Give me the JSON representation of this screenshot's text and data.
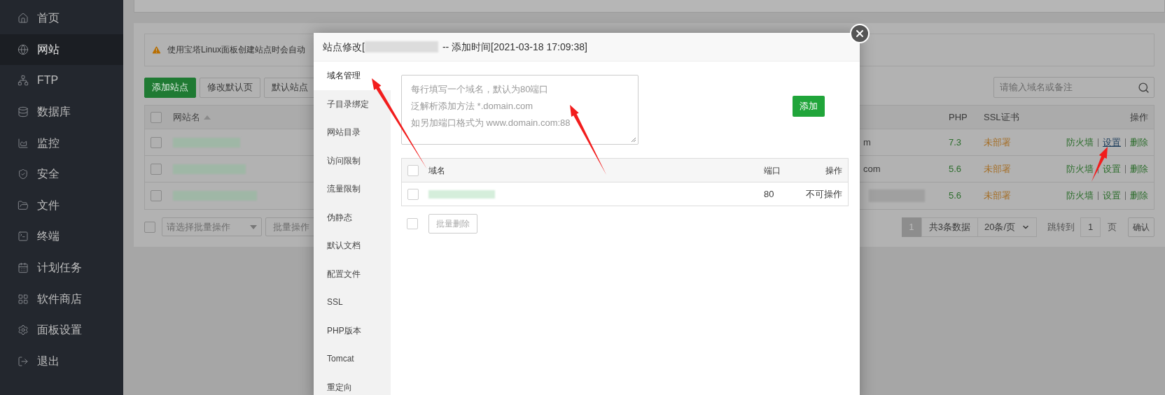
{
  "sidebar": {
    "items": [
      {
        "label": "首页",
        "selected": false
      },
      {
        "label": "网站",
        "selected": true
      },
      {
        "label": "FTP",
        "selected": false
      },
      {
        "label": "数据库",
        "selected": false
      },
      {
        "label": "监控",
        "selected": false
      },
      {
        "label": "安全",
        "selected": false
      },
      {
        "label": "文件",
        "selected": false
      },
      {
        "label": "终端",
        "selected": false
      },
      {
        "label": "计划任务",
        "selected": false
      },
      {
        "label": "软件商店",
        "selected": false
      },
      {
        "label": "面板设置",
        "selected": false
      },
      {
        "label": "退出",
        "selected": false
      }
    ]
  },
  "notice": "使用宝塔Linux面板创建站点时会自动",
  "toolbar": {
    "buttons": [
      {
        "label": "添加站点",
        "kind": "primary"
      },
      {
        "label": "修改默认页",
        "kind": "default"
      },
      {
        "label": "默认站点",
        "kind": "default"
      }
    ],
    "search": {
      "placeholder": "请输入域名或备注"
    }
  },
  "sites_table": {
    "header_checked": false,
    "columns": {
      "name": "网站名",
      "php": "PHP",
      "ssl": "SSL证书",
      "actions": "操作"
    },
    "rows": [
      {
        "checked": false,
        "tail": "m",
        "tail_blurred": false,
        "php": "7.3",
        "ssl": "未部署",
        "actions": [
          {
            "label": "防火墙",
            "hovered": false
          },
          {
            "label": "设置",
            "hovered": true
          },
          {
            "label": "删除",
            "hovered": false
          }
        ]
      },
      {
        "checked": false,
        "tail": "com",
        "tail_blurred": false,
        "php": "5.6",
        "ssl": "未部署",
        "actions": [
          {
            "label": "防火墙",
            "hovered": false
          },
          {
            "label": "设置",
            "hovered": false
          },
          {
            "label": "删除",
            "hovered": false
          }
        ]
      },
      {
        "checked": false,
        "tail": "",
        "tail_blurred": true,
        "php": "5.6",
        "ssl": "未部署",
        "actions": [
          {
            "label": "防火墙",
            "hovered": false
          },
          {
            "label": "设置",
            "hovered": false
          },
          {
            "label": "删除",
            "hovered": false
          }
        ]
      }
    ]
  },
  "footer": {
    "checked": false,
    "batch_select": {
      "placeholder": "请选择批量操作"
    },
    "batch_button": "批量操作",
    "pagination": {
      "current": "1",
      "total": "共3条数据",
      "per_page": "20条/页",
      "jump_label": "跳转到",
      "jump_value": "1",
      "page_unit": "页",
      "confirm": "确认"
    }
  },
  "modal": {
    "title_prefix": "站点修改[",
    "title_suffix": "-- 添加时间[2021-03-18 17:09:38]",
    "nav": [
      {
        "label": "域名管理",
        "selected": true
      },
      {
        "label": "子目录绑定",
        "selected": false
      },
      {
        "label": "网站目录",
        "selected": false
      },
      {
        "label": "访问限制",
        "selected": false
      },
      {
        "label": "流量限制",
        "selected": false
      },
      {
        "label": "伪静态",
        "selected": false
      },
      {
        "label": "默认文档",
        "selected": false
      },
      {
        "label": "配置文件",
        "selected": false
      },
      {
        "label": "SSL",
        "selected": false
      },
      {
        "label": "PHP版本",
        "selected": false
      },
      {
        "label": "Tomcat",
        "selected": false
      },
      {
        "label": "重定向",
        "selected": false
      }
    ],
    "domain_input": {
      "placeholder_lines": [
        "每行填写一个域名，默认为80端口",
        "泛解析添加方法 *.domain.com",
        "如另加端口格式为 www.domain.com:88"
      ]
    },
    "add_button": "添加",
    "table": {
      "header_checked": false,
      "columns": {
        "domain": "域名",
        "port": "端口",
        "actions": "操作"
      },
      "rows": [
        {
          "checked": false,
          "port": "80",
          "action": "不可操作"
        }
      ]
    },
    "footer": {
      "checked": false,
      "delete_button": "批量删除"
    }
  }
}
